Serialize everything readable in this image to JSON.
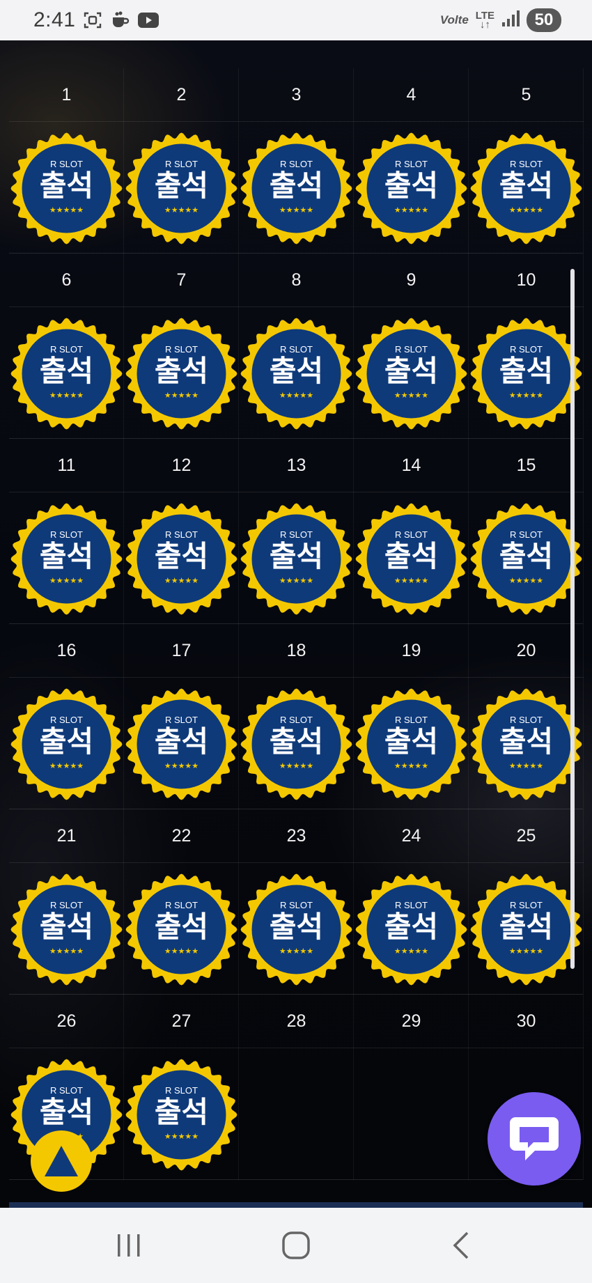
{
  "status_bar": {
    "time": "2:41",
    "icons": [
      "screenshot-icon",
      "coffee-icon",
      "youtube-icon"
    ],
    "volte": "Volte",
    "network": "LTE",
    "battery": "50"
  },
  "calendar": {
    "badge": {
      "brand": "R SLOT",
      "label": "출석",
      "stars": "★★★★★",
      "colors": {
        "ring": "#f4c800",
        "fill": "#0e3a7a",
        "text": "#ffffff",
        "stars": "#f4c800"
      }
    },
    "days": [
      {
        "n": "1",
        "stamped": true
      },
      {
        "n": "2",
        "stamped": true
      },
      {
        "n": "3",
        "stamped": true
      },
      {
        "n": "4",
        "stamped": true
      },
      {
        "n": "5",
        "stamped": true
      },
      {
        "n": "6",
        "stamped": true
      },
      {
        "n": "7",
        "stamped": true
      },
      {
        "n": "8",
        "stamped": true
      },
      {
        "n": "9",
        "stamped": true
      },
      {
        "n": "10",
        "stamped": true
      },
      {
        "n": "11",
        "stamped": true
      },
      {
        "n": "12",
        "stamped": true
      },
      {
        "n": "13",
        "stamped": true
      },
      {
        "n": "14",
        "stamped": true
      },
      {
        "n": "15",
        "stamped": true
      },
      {
        "n": "16",
        "stamped": true
      },
      {
        "n": "17",
        "stamped": true
      },
      {
        "n": "18",
        "stamped": true
      },
      {
        "n": "19",
        "stamped": true
      },
      {
        "n": "20",
        "stamped": true
      },
      {
        "n": "21",
        "stamped": true
      },
      {
        "n": "22",
        "stamped": true
      },
      {
        "n": "23",
        "stamped": true
      },
      {
        "n": "24",
        "stamped": true
      },
      {
        "n": "25",
        "stamped": true
      },
      {
        "n": "26",
        "stamped": true
      },
      {
        "n": "27",
        "stamped": true
      },
      {
        "n": "28",
        "stamped": false
      },
      {
        "n": "29",
        "stamped": false
      },
      {
        "n": "30",
        "stamped": false
      }
    ]
  },
  "floating": {
    "scroll_top_icon": "triangle-up-icon",
    "chat_icon": "chat-bubble-icon",
    "colors": {
      "scroll_top": "#f4c800",
      "chat": "#7a5cf0"
    }
  },
  "nav_bar": {
    "icons": [
      "recent-apps-icon",
      "home-icon",
      "back-icon"
    ]
  }
}
